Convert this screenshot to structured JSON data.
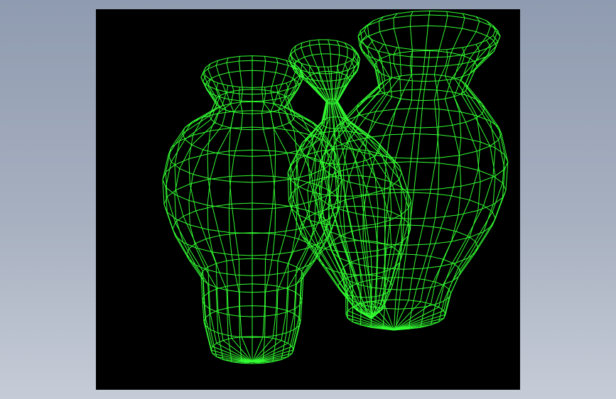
{
  "scene": {
    "background_color": "#000000",
    "wire_color": "#33ff33",
    "subject": "wireframe-vases"
  },
  "page": {
    "background_gradient": [
      "#8f9bb0",
      "#c6ccd7"
    ]
  }
}
